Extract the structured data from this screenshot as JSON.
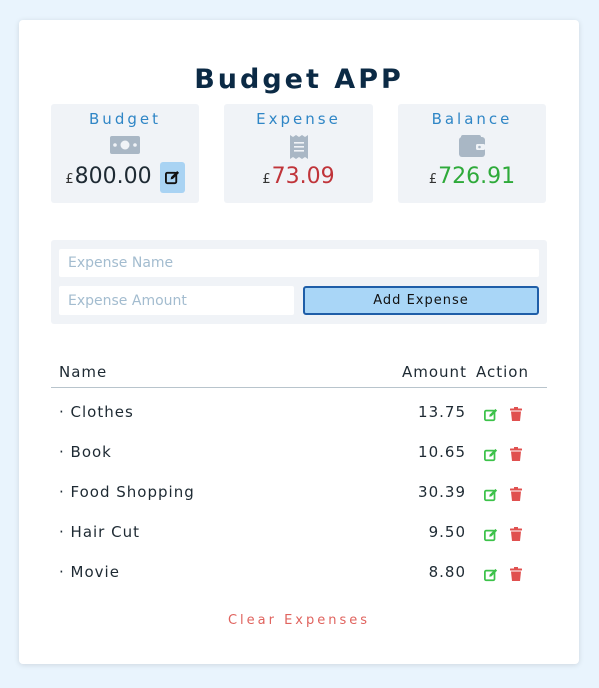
{
  "app": {
    "title": "Budget APP"
  },
  "stats": {
    "budget": {
      "label": "Budget",
      "currency": "£",
      "value": "800.00",
      "icon": "banknote-icon"
    },
    "expense": {
      "label": "Expense",
      "currency": "£",
      "value": "73.09",
      "icon": "receipt-icon"
    },
    "balance": {
      "label": "Balance",
      "currency": "£",
      "value": "726.91",
      "icon": "wallet-icon"
    }
  },
  "form": {
    "name_placeholder": "Expense Name",
    "amount_placeholder": "Expense Amount",
    "add_label": "Add Expense"
  },
  "table": {
    "headers": {
      "name": "Name",
      "amount": "Amount",
      "action": "Action"
    },
    "rows": [
      {
        "name": "· Clothes",
        "amount": "13.75"
      },
      {
        "name": "· Book",
        "amount": "10.65"
      },
      {
        "name": "· Food Shopping",
        "amount": "30.39"
      },
      {
        "name": "· Hair Cut",
        "amount": "9.50"
      },
      {
        "name": "· Movie",
        "amount": "8.80"
      }
    ]
  },
  "clear_label": "Clear Expenses",
  "colors": {
    "accent": "#2f86c6",
    "expense": "#c0343a",
    "balance": "#2eaa3a",
    "edit": "#3cc24a",
    "delete": "#e0504f",
    "clear": "#e0635e"
  }
}
